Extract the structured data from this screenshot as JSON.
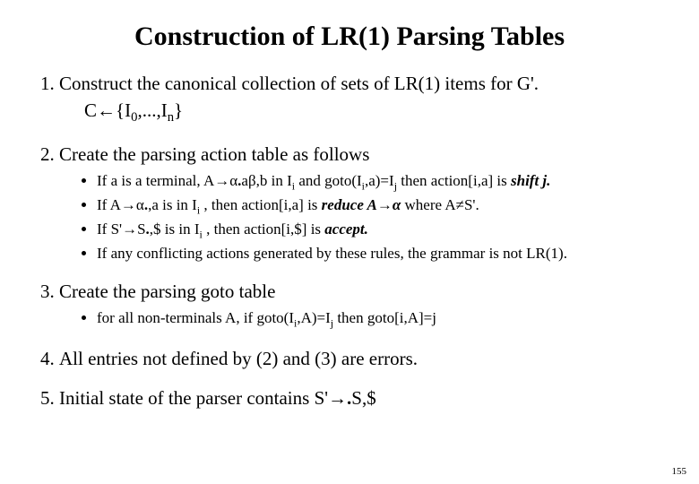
{
  "title": "Construction of LR(1) Parsing Tables",
  "items": {
    "one": {
      "text": "Construct the canonical collection of sets of LR(1) items  for G'.",
      "sub_prefix": "C←{I",
      "sub_mid": ",...,I",
      "sub_suffix": "}"
    },
    "two": {
      "text": "Create the parsing action table as follows",
      "b1_a": "If  a is a terminal, A→α",
      "b1_b": "aβ,b in I",
      "b1_c": " and goto(I",
      "b1_d": ",a)=I",
      "b1_e": " then action[i,a] is ",
      "b1_shift": "shift j.",
      "b2_a": "If  A→α",
      "b2_b": ",a  is in I",
      "b2_c": " , then action[i,a] is ",
      "b2_reduce": "reduce A→α",
      "b2_d": "  where A≠S'.",
      "b3_a": "If  S'→S",
      "b3_b": ",$  is in I",
      "b3_c": " , then action[i,$] is ",
      "b3_accept": "accept.",
      "b4": "If any conflicting actions generated by these rules, the grammar is not LR(1)."
    },
    "three": {
      "text": "Create the parsing goto table",
      "b1_a": "for all non-terminals A,  if goto(I",
      "b1_b": ",A)=I",
      "b1_c": "  then goto[i,A]=j"
    },
    "four": {
      "text": "All entries not defined by (2) and (3) are errors."
    },
    "five": {
      "a": "Initial state of the parser contains  S'→",
      "b": "S,$"
    }
  },
  "sub": {
    "zero": "0",
    "n": "n",
    "i": "i",
    "j": "j"
  },
  "dot": ".",
  "page_number": "155"
}
